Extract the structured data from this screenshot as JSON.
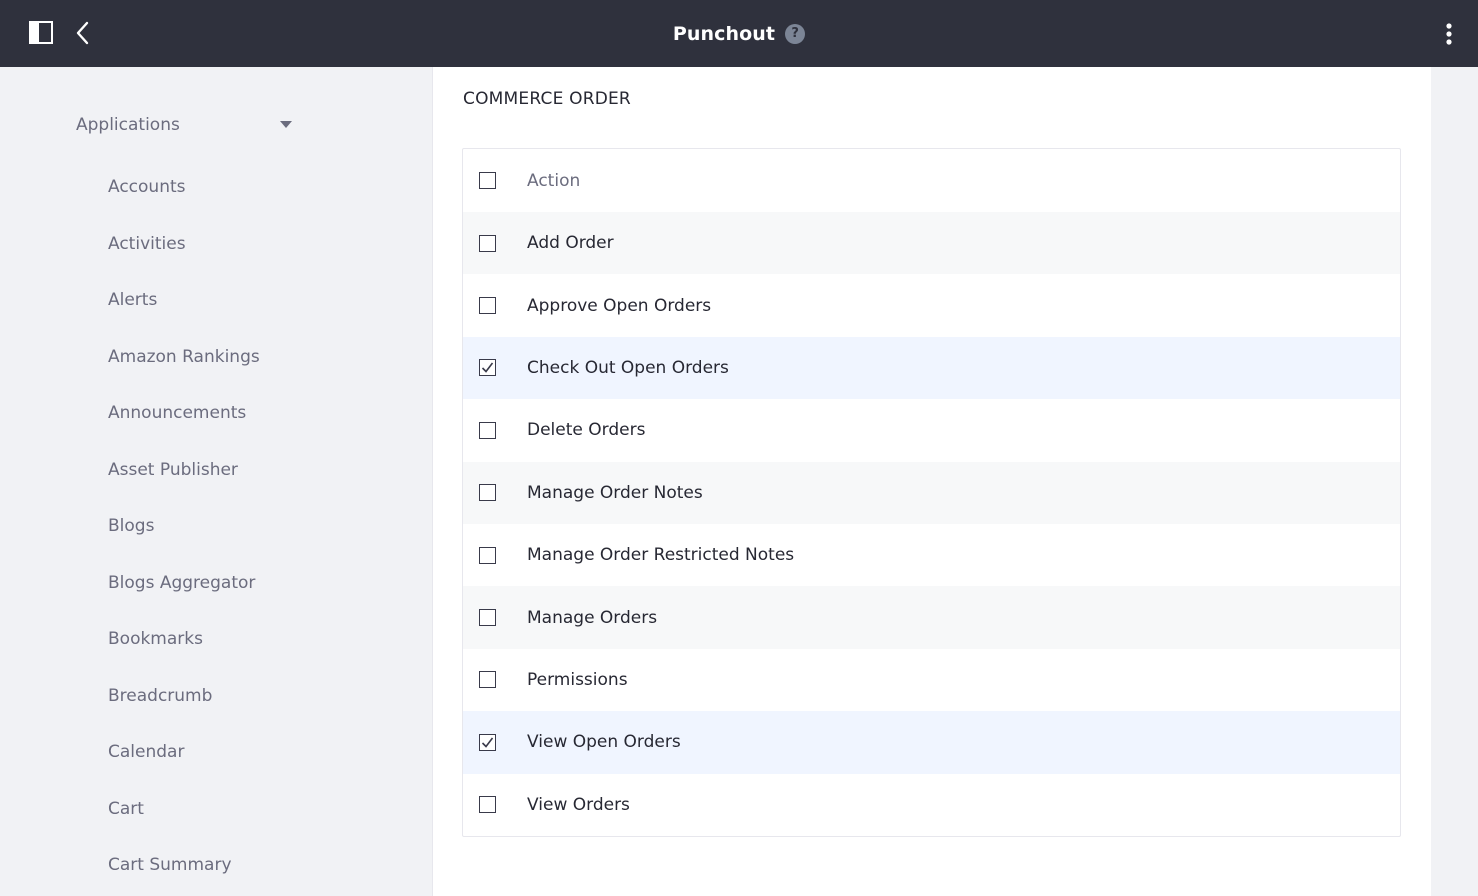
{
  "header": {
    "title": "Punchout",
    "help_label": "?"
  },
  "sidebar": {
    "section_label": "Applications",
    "items": [
      "Accounts",
      "Activities",
      "Alerts",
      "Amazon Rankings",
      "Announcements",
      "Asset Publisher",
      "Blogs",
      "Blogs Aggregator",
      "Bookmarks",
      "Breadcrumb",
      "Calendar",
      "Cart",
      "Cart Summary"
    ]
  },
  "main": {
    "section_title": "COMMERCE ORDER",
    "column_header": "Action",
    "rows": [
      {
        "label": "Add Order",
        "checked": false
      },
      {
        "label": "Approve Open Orders",
        "checked": false
      },
      {
        "label": "Check Out Open Orders",
        "checked": true
      },
      {
        "label": "Delete Orders",
        "checked": false
      },
      {
        "label": "Manage Order Notes",
        "checked": false
      },
      {
        "label": "Manage Order Restricted Notes",
        "checked": false
      },
      {
        "label": "Manage Orders",
        "checked": false
      },
      {
        "label": "Permissions",
        "checked": false
      },
      {
        "label": "View Open Orders",
        "checked": true
      },
      {
        "label": "View Orders",
        "checked": false
      }
    ]
  },
  "colors": {
    "topbar_bg": "#2f313d",
    "sidebar_bg": "#f1f2f5",
    "selected_row_bg": "#f0f5ff",
    "stripe_row_bg": "#f7f8f9"
  },
  "icons": {
    "panel_toggle": "sidebar-panel-icon",
    "back": "chevron-left-icon",
    "help": "question-circle-icon",
    "menu": "ellipsis-vertical-icon",
    "section_toggle": "caret-down-icon",
    "checkbox_checked": "check-icon"
  }
}
